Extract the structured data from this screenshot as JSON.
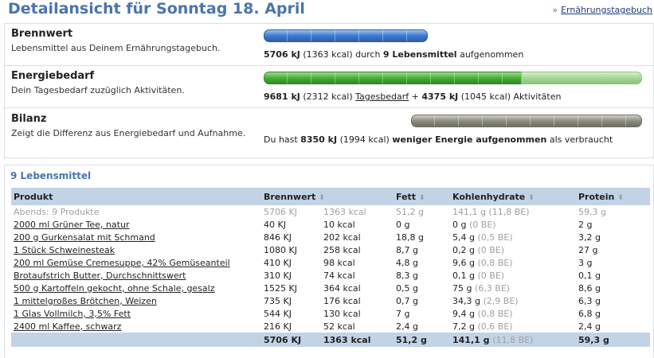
{
  "page": {
    "title": "Detailansicht für Sonntag 18. April",
    "link_arrow": "»",
    "link_label": "Ernährungstagebuch"
  },
  "summary": {
    "brennwert": {
      "title": "Brennwert",
      "desc": "Lebensmittel aus Deinem Ernährungstagebuch.",
      "kj": "5706 kJ",
      "kcal": "(1363 kcal)",
      "mid": "durch",
      "count": "9 Lebensmittel",
      "suffix": "aufgenommen",
      "bar_fraction": 0.43
    },
    "energiebedarf": {
      "title": "Energiebedarf",
      "desc": "Dein Tagesbedarf zuzüglich Aktivitäten.",
      "kj": "9681 kJ",
      "kcal": "(2312 kcal)",
      "link": "Tagesbedarf",
      "plus": "+",
      "act_kj": "4375 kJ",
      "act_kcal": "(1045 kcal)",
      "act_label": "Aktivitäten",
      "bar_fraction_dark": 0.68,
      "bar_fraction_total": 1.0
    },
    "bilanz": {
      "title": "Bilanz",
      "desc": "Zeigt die Differenz aus Energiebedarf und Aufnahme.",
      "prefix": "Du hast",
      "kj": "8350 kJ",
      "kcal": "(1994 kcal)",
      "bold_text": "weniger Energie aufgenommen",
      "suffix": "als verbraucht",
      "bar_start": 0.39,
      "bar_end": 1.0
    }
  },
  "foods": {
    "title": "9 Lebensmittel",
    "columns": {
      "product": "Produkt",
      "brennwert": "Brennwert",
      "fett": "Fett",
      "kohlenhydrate": "Kohlenhydrate",
      "protein": "Protein",
      "sort_icon": "⬍"
    },
    "subtotal": {
      "name": "Abends: 9 Produkte",
      "kj": "5706 KJ",
      "kcal": "1363 kcal",
      "fett": "51,2 g",
      "kh": "141,1 g",
      "be": "(11,8 BE)",
      "protein": "59,3 g"
    },
    "items": [
      {
        "name": "2000 ml Grüner Tee, natur",
        "kj": "40 KJ",
        "kcal": "10 kcal",
        "fett": "0 g",
        "kh": "0 g",
        "be": "(0 BE)",
        "protein": "2 g"
      },
      {
        "name": "200 g Gurkensalat mit Schmand",
        "kj": "846 KJ",
        "kcal": "202 kcal",
        "fett": "18,8 g",
        "kh": "5,4 g",
        "be": "(0,5 BE)",
        "protein": "3,2 g"
      },
      {
        "name": "1 Stück Schweinesteak",
        "kj": "1080 KJ",
        "kcal": "258 kcal",
        "fett": "8,7 g",
        "kh": "0,2 g",
        "be": "(0 BE)",
        "protein": "27 g"
      },
      {
        "name": "200 ml Gemüse Cremesuppe, 42% Gemüseanteil",
        "kj": "410 KJ",
        "kcal": "98 kcal",
        "fett": "4,8 g",
        "kh": "9,6 g",
        "be": "(0,8 BE)",
        "protein": "3 g"
      },
      {
        "name": "Brotaufstrich Butter, Durchschnittswert",
        "kj": "310 KJ",
        "kcal": "74 kcal",
        "fett": "8,3 g",
        "kh": "0,1 g",
        "be": "(0 BE)",
        "protein": "0,1 g"
      },
      {
        "name": "500 g Kartoffeln gekocht, ohne Schale, gesalz",
        "kj": "1525 KJ",
        "kcal": "364 kcal",
        "fett": "0,5 g",
        "kh": "75 g",
        "be": "(6,3 BE)",
        "protein": "8,6 g"
      },
      {
        "name": "1 mittelgroßes Brötchen, Weizen",
        "kj": "735 KJ",
        "kcal": "176 kcal",
        "fett": "0,7 g",
        "kh": "34,3 g",
        "be": "(2,9 BE)",
        "protein": "6,3 g"
      },
      {
        "name": "1 Glas Vollmilch, 3,5% Fett",
        "kj": "544 KJ",
        "kcal": "130 kcal",
        "fett": "7 g",
        "kh": "9,4 g",
        "be": "(0,8 BE)",
        "protein": "6,8 g"
      },
      {
        "name": "2400 ml Kaffee, schwarz",
        "kj": "216 KJ",
        "kcal": "52 kcal",
        "fett": "2,4 g",
        "kh": "7,2 g",
        "be": "(0,6 BE)",
        "protein": "2,4 g"
      }
    ],
    "total": {
      "kj": "5706 KJ",
      "kcal": "1363 kcal",
      "fett": "51,2 g",
      "kh": "141,1 g",
      "be": "(11,8 BE)",
      "protein": "59,3 g"
    }
  }
}
